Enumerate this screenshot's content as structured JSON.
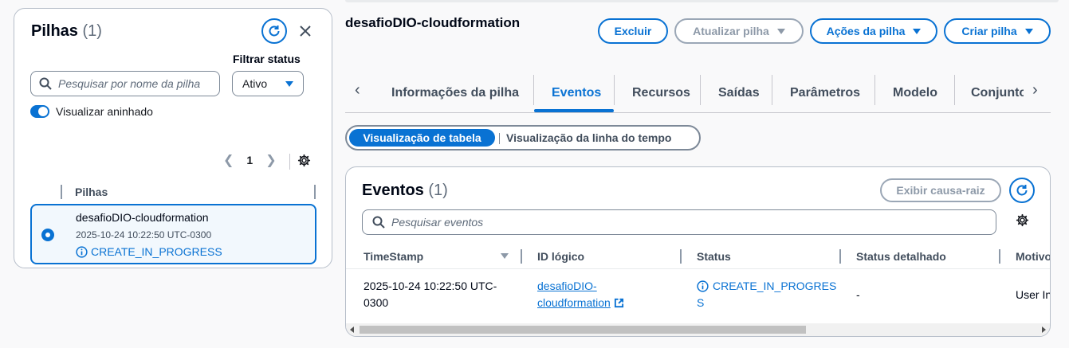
{
  "stacks_panel": {
    "title": "Pilhas",
    "count": "(1)",
    "filter_label": "Filtrar status",
    "search_placeholder": "Pesquisar por nome da pilha",
    "filter_value": "Ativo",
    "nested_toggle_label": "Visualizar aninhado",
    "page_number": "1",
    "column_header": "Pilhas",
    "stack": {
      "name": "desafioDIO-cloudformation",
      "timestamp": "2025-10-24 10:22:50 UTC-0300",
      "status": "CREATE_IN_PROGRESS"
    }
  },
  "header": {
    "stack_title": "desafioDIO-cloudformation",
    "buttons": {
      "delete": "Excluir",
      "update": "Atualizar pilha",
      "stack_actions": "Ações da pilha",
      "create": "Criar pilha"
    }
  },
  "tabs": [
    "Informações da pilha",
    "Eventos",
    "Recursos",
    "Saídas",
    "Parâmetros",
    "Modelo",
    "Conjunto"
  ],
  "view_toggle": {
    "table": "Visualização de tabela",
    "timeline": "Visualização da linha do tempo"
  },
  "events": {
    "title": "Eventos",
    "count": "(1)",
    "root_cause_button": "Exibir causa-raiz",
    "search_placeholder": "Pesquisar eventos",
    "columns": [
      "TimeStamp",
      "ID lógico",
      "Status",
      "Status detalhado",
      "Motivo"
    ],
    "row": {
      "timestamp_line1": "2025-10-24 10:22:50 UTC-",
      "timestamp_line2": "0300",
      "logical_id_line1": "desafioDIO-",
      "logical_id_line2": "cloudformation",
      "status_line1": "CREATE_IN_PROGRES",
      "status_line2": "S",
      "detailed_status": "-",
      "reason": "User In"
    }
  },
  "colors": {
    "accent": "#0972d3",
    "disabled": "#8d99a8",
    "border": "#b6bec9"
  }
}
